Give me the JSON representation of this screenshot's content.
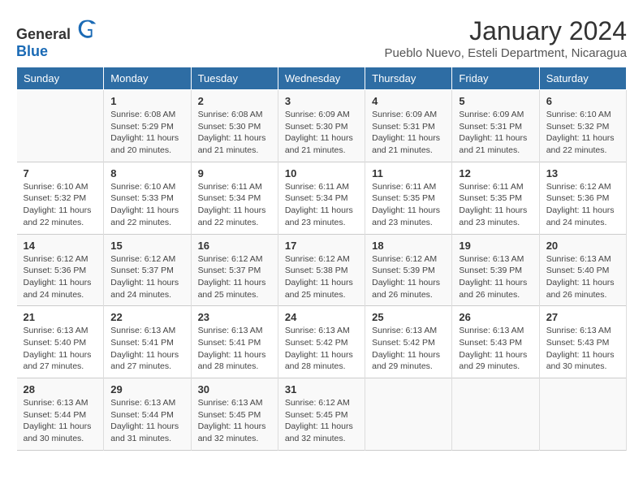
{
  "logo": {
    "text_general": "General",
    "text_blue": "Blue"
  },
  "title": "January 2024",
  "subtitle": "Pueblo Nuevo, Esteli Department, Nicaragua",
  "days_of_week": [
    "Sunday",
    "Monday",
    "Tuesday",
    "Wednesday",
    "Thursday",
    "Friday",
    "Saturday"
  ],
  "weeks": [
    [
      {
        "day": "",
        "sunrise": "",
        "sunset": "",
        "daylight": ""
      },
      {
        "day": "1",
        "sunrise": "6:08 AM",
        "sunset": "5:29 PM",
        "daylight": "11 hours and 20 minutes."
      },
      {
        "day": "2",
        "sunrise": "6:08 AM",
        "sunset": "5:30 PM",
        "daylight": "11 hours and 21 minutes."
      },
      {
        "day": "3",
        "sunrise": "6:09 AM",
        "sunset": "5:30 PM",
        "daylight": "11 hours and 21 minutes."
      },
      {
        "day": "4",
        "sunrise": "6:09 AM",
        "sunset": "5:31 PM",
        "daylight": "11 hours and 21 minutes."
      },
      {
        "day": "5",
        "sunrise": "6:09 AM",
        "sunset": "5:31 PM",
        "daylight": "11 hours and 21 minutes."
      },
      {
        "day": "6",
        "sunrise": "6:10 AM",
        "sunset": "5:32 PM",
        "daylight": "11 hours and 22 minutes."
      }
    ],
    [
      {
        "day": "7",
        "sunrise": "6:10 AM",
        "sunset": "5:32 PM",
        "daylight": "11 hours and 22 minutes."
      },
      {
        "day": "8",
        "sunrise": "6:10 AM",
        "sunset": "5:33 PM",
        "daylight": "11 hours and 22 minutes."
      },
      {
        "day": "9",
        "sunrise": "6:11 AM",
        "sunset": "5:34 PM",
        "daylight": "11 hours and 22 minutes."
      },
      {
        "day": "10",
        "sunrise": "6:11 AM",
        "sunset": "5:34 PM",
        "daylight": "11 hours and 23 minutes."
      },
      {
        "day": "11",
        "sunrise": "6:11 AM",
        "sunset": "5:35 PM",
        "daylight": "11 hours and 23 minutes."
      },
      {
        "day": "12",
        "sunrise": "6:11 AM",
        "sunset": "5:35 PM",
        "daylight": "11 hours and 23 minutes."
      },
      {
        "day": "13",
        "sunrise": "6:12 AM",
        "sunset": "5:36 PM",
        "daylight": "11 hours and 24 minutes."
      }
    ],
    [
      {
        "day": "14",
        "sunrise": "6:12 AM",
        "sunset": "5:36 PM",
        "daylight": "11 hours and 24 minutes."
      },
      {
        "day": "15",
        "sunrise": "6:12 AM",
        "sunset": "5:37 PM",
        "daylight": "11 hours and 24 minutes."
      },
      {
        "day": "16",
        "sunrise": "6:12 AM",
        "sunset": "5:37 PM",
        "daylight": "11 hours and 25 minutes."
      },
      {
        "day": "17",
        "sunrise": "6:12 AM",
        "sunset": "5:38 PM",
        "daylight": "11 hours and 25 minutes."
      },
      {
        "day": "18",
        "sunrise": "6:12 AM",
        "sunset": "5:39 PM",
        "daylight": "11 hours and 26 minutes."
      },
      {
        "day": "19",
        "sunrise": "6:13 AM",
        "sunset": "5:39 PM",
        "daylight": "11 hours and 26 minutes."
      },
      {
        "day": "20",
        "sunrise": "6:13 AM",
        "sunset": "5:40 PM",
        "daylight": "11 hours and 26 minutes."
      }
    ],
    [
      {
        "day": "21",
        "sunrise": "6:13 AM",
        "sunset": "5:40 PM",
        "daylight": "11 hours and 27 minutes."
      },
      {
        "day": "22",
        "sunrise": "6:13 AM",
        "sunset": "5:41 PM",
        "daylight": "11 hours and 27 minutes."
      },
      {
        "day": "23",
        "sunrise": "6:13 AM",
        "sunset": "5:41 PM",
        "daylight": "11 hours and 28 minutes."
      },
      {
        "day": "24",
        "sunrise": "6:13 AM",
        "sunset": "5:42 PM",
        "daylight": "11 hours and 28 minutes."
      },
      {
        "day": "25",
        "sunrise": "6:13 AM",
        "sunset": "5:42 PM",
        "daylight": "11 hours and 29 minutes."
      },
      {
        "day": "26",
        "sunrise": "6:13 AM",
        "sunset": "5:43 PM",
        "daylight": "11 hours and 29 minutes."
      },
      {
        "day": "27",
        "sunrise": "6:13 AM",
        "sunset": "5:43 PM",
        "daylight": "11 hours and 30 minutes."
      }
    ],
    [
      {
        "day": "28",
        "sunrise": "6:13 AM",
        "sunset": "5:44 PM",
        "daylight": "11 hours and 30 minutes."
      },
      {
        "day": "29",
        "sunrise": "6:13 AM",
        "sunset": "5:44 PM",
        "daylight": "11 hours and 31 minutes."
      },
      {
        "day": "30",
        "sunrise": "6:13 AM",
        "sunset": "5:45 PM",
        "daylight": "11 hours and 32 minutes."
      },
      {
        "day": "31",
        "sunrise": "6:12 AM",
        "sunset": "5:45 PM",
        "daylight": "11 hours and 32 minutes."
      },
      {
        "day": "",
        "sunrise": "",
        "sunset": "",
        "daylight": ""
      },
      {
        "day": "",
        "sunrise": "",
        "sunset": "",
        "daylight": ""
      },
      {
        "day": "",
        "sunrise": "",
        "sunset": "",
        "daylight": ""
      }
    ]
  ],
  "labels": {
    "sunrise": "Sunrise:",
    "sunset": "Sunset:",
    "daylight": "Daylight:"
  }
}
